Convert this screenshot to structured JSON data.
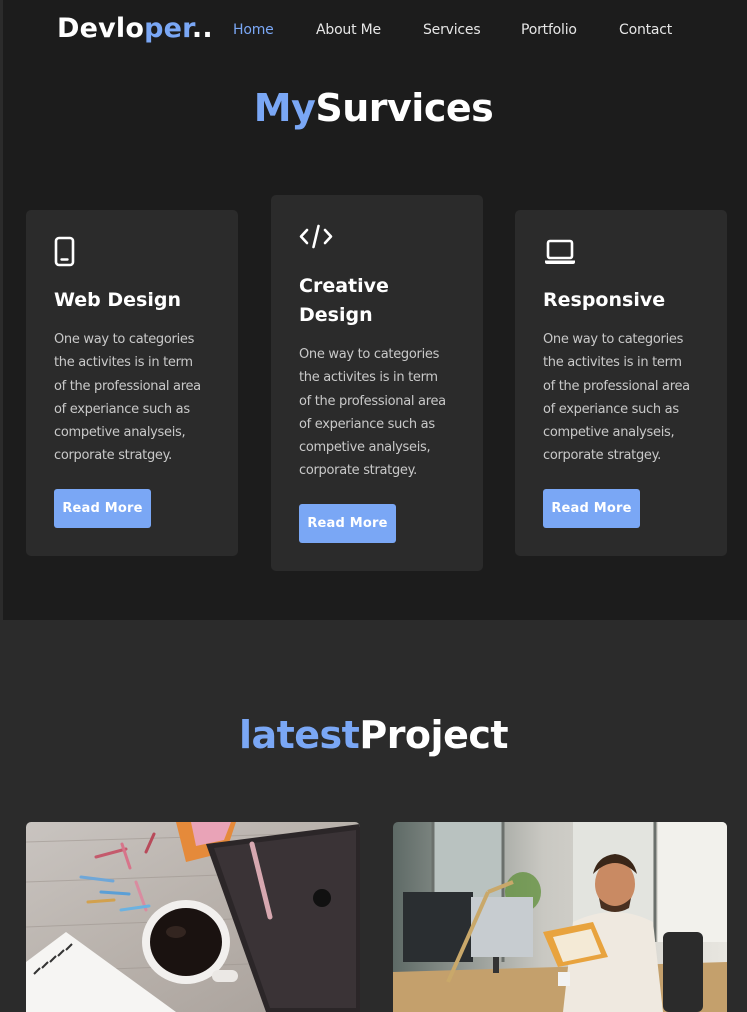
{
  "logo": {
    "part1": "Devlo",
    "accent": "per",
    "part2": ".."
  },
  "nav": {
    "items": [
      "Home",
      "About Me",
      "Services",
      "Portfolio",
      "Contact"
    ],
    "active": "Home"
  },
  "services": {
    "title_accent": "My",
    "title_rest": "Survices",
    "cards": [
      {
        "icon": "mobile-phone-icon",
        "title": "Web Design",
        "lines": [
          "One way to categories",
          "the activites is in term",
          "of the professional area",
          "of experiance such as",
          "competive analyseis,",
          "corporate stratgey."
        ],
        "button": "Read More"
      },
      {
        "icon": "code-icon",
        "title_lines": [
          "Creative",
          "Design"
        ],
        "lines": [
          "One way to categories",
          "the activites is in term",
          "of the professional area",
          "of experiance such as",
          "competive analyseis,",
          "corporate stratgey."
        ],
        "button": "Read More"
      },
      {
        "icon": "laptop-icon",
        "title": "Responsive",
        "lines": [
          "One way to categories",
          "the activites is in term",
          "of the professional area",
          "of experiance such as",
          "competive analyseis,",
          "corporate stratgey."
        ],
        "button": "Read More"
      }
    ]
  },
  "projects": {
    "title_accent": "latest",
    "title_rest": "Project",
    "items": [
      {
        "image": "desk-with-tablet-and-coffee-photo"
      },
      {
        "image": "man-at-office-desk-with-book-photo"
      }
    ]
  },
  "colors": {
    "accent": "#7aa7f5",
    "background": "#1c1c1c",
    "card": "#2b2b2b"
  }
}
